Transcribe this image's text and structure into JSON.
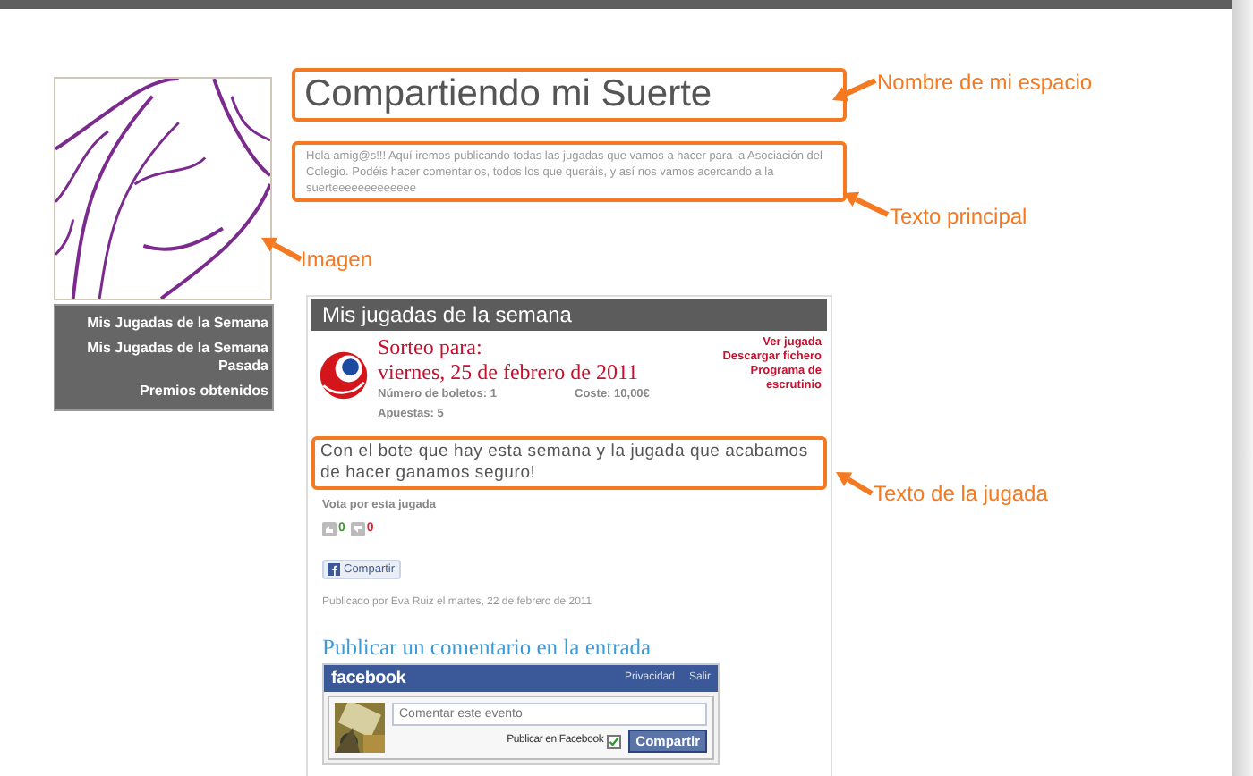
{
  "blog": {
    "title": "Compartiendo mi Suerte",
    "description": "Hola amig@s!!! Aquí iremos publicando todas las jugadas que vamos a hacer para la Asociación del Colegio. Podéis hacer comentarios, todos los que queráis, y así nos vamos acercando a la suerteeeeeeeeeeeee"
  },
  "sidebar": {
    "items": [
      {
        "label": "Mis Jugadas de la Semana"
      },
      {
        "label": "Mis Jugadas de la Semana Pasada"
      },
      {
        "label": "Premios obtenidos"
      }
    ]
  },
  "post": {
    "title": "Mis jugadas de la semana",
    "draw_label": "Sorteo para:",
    "draw_date": "viernes, 25 de febrero de 2011",
    "details": [
      "Número de boletos: 1",
      "Coste: 10,00€",
      "Apuestas: 5"
    ],
    "links": [
      "Ver jugada",
      "Descargar fichero",
      "Programa de escrutinio"
    ],
    "text": "Con el bote que hay esta semana y la jugada que acabamos de hacer ganamos seguro!",
    "vote_label": "Vota por esta jugada",
    "votes_up": "0",
    "votes_down": "0",
    "share": "Compartir",
    "byline": "Publicado por Eva Ruiz el martes, 22 de febrero de 2011"
  },
  "comments": {
    "heading": "Publicar un comentario en la entrada",
    "brand": "facebook",
    "links": [
      "Privacidad",
      "Salir"
    ],
    "placeholder": "Comentar este evento",
    "publish_label": "Publicar en Facebook",
    "publish_checked": true,
    "button": "Compartir"
  },
  "annotations": [
    {
      "text": "Nombre de mi espacio"
    },
    {
      "text": "Texto principal"
    },
    {
      "text": "Imagen"
    },
    {
      "text": "Texto de la jugada"
    }
  ]
}
